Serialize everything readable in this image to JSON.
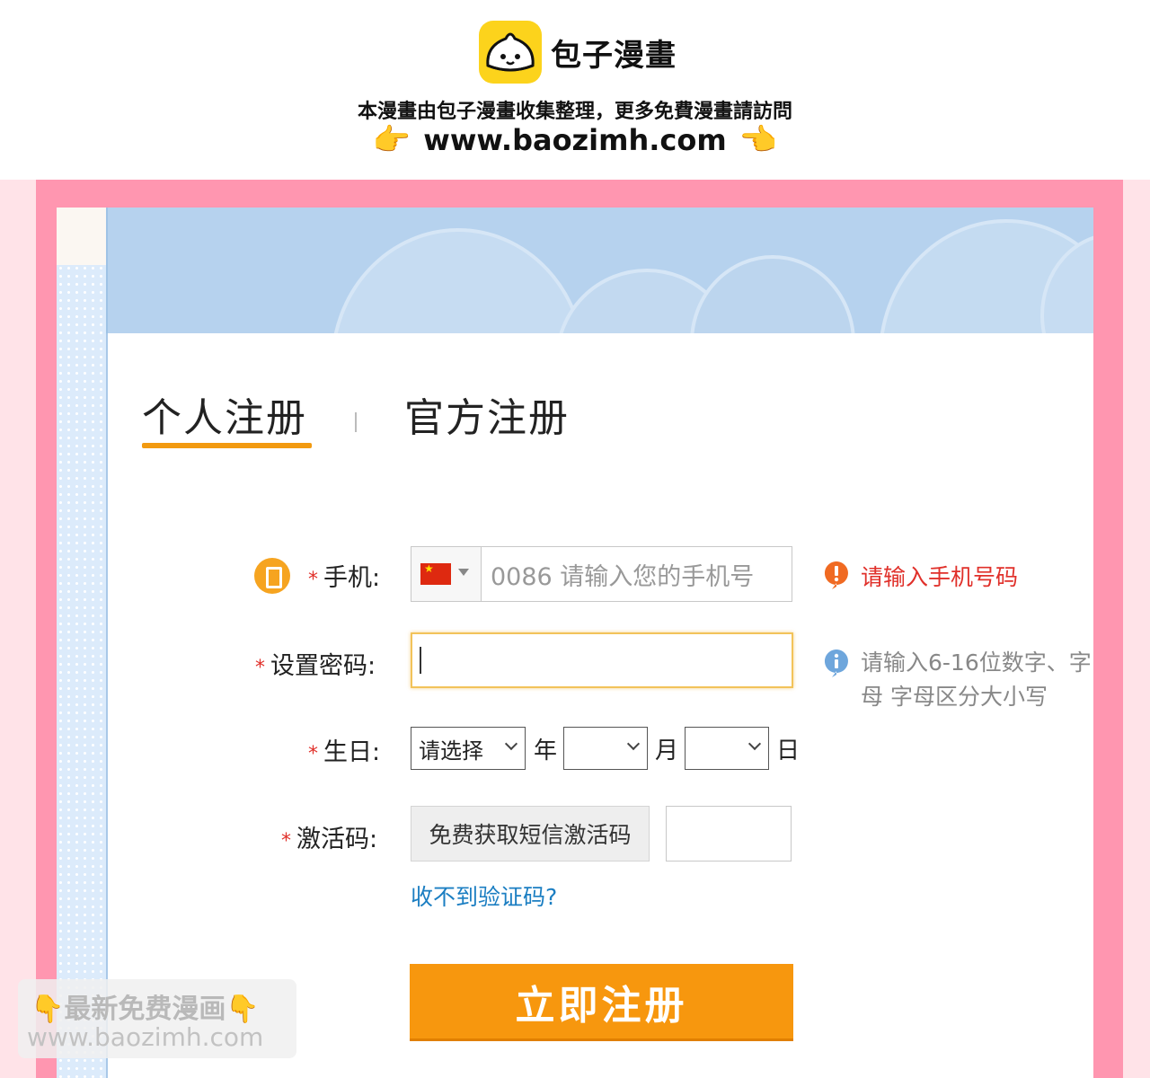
{
  "banner": {
    "brand_name": "包子漫畫",
    "promo_text": "本漫畫由包子漫畫收集整理，更多免費漫畫請訪問",
    "site_url": "www.baozimh.com",
    "hand_left": "👉",
    "hand_right": "👈"
  },
  "tabs": {
    "personal": "个人注册",
    "official": "官方注册"
  },
  "form": {
    "phone": {
      "label": "手机:",
      "required_mark": "*",
      "placeholder": "0086 请输入您的手机号",
      "error_message": "请输入手机号码"
    },
    "password": {
      "label": "设置密码:",
      "required_mark": "*",
      "hint": "请输入6-16位数字、字母 字母区分大小写"
    },
    "birthday": {
      "label": "生日:",
      "required_mark": "*",
      "year_selected": "请选择",
      "year_unit": "年",
      "month_unit": "月",
      "day_unit": "日"
    },
    "activation": {
      "label": "激活码:",
      "required_mark": "*",
      "sms_button": "免费获取短信激活码",
      "help_link": "收不到验证码?"
    },
    "submit": "立即注册"
  },
  "watermark": {
    "line1_text": "最新免费漫画",
    "line2": "www.baozimh.com",
    "hand": "👇"
  },
  "colors": {
    "accent_orange": "#f7970e",
    "error_red": "#e0302a",
    "link_blue": "#1b7ec2",
    "frame_pink": "#ff96b0",
    "logo_yellow": "#fcd31c"
  }
}
